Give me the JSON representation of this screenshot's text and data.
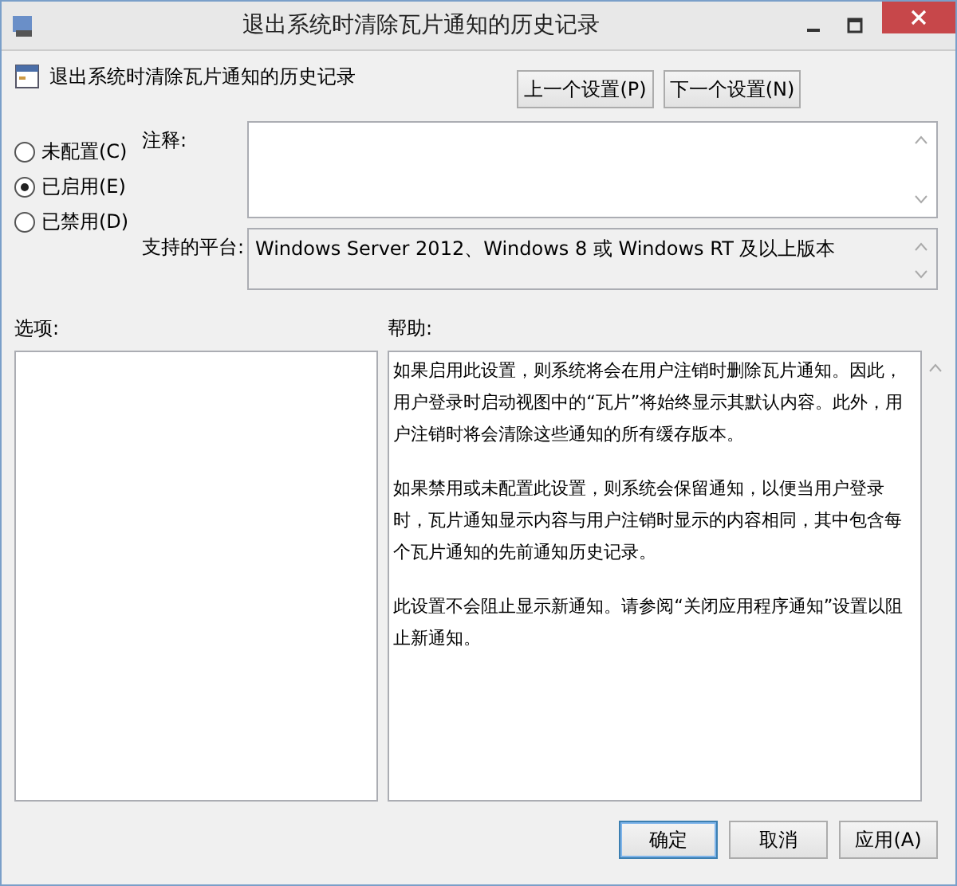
{
  "window": {
    "title": "退出系统时清除瓦片通知的历史记录"
  },
  "policy": {
    "name": "退出系统时清除瓦片通知的历史记录"
  },
  "nav_buttons": [
    "上一个设置(P)",
    "下一个设置(N)"
  ],
  "options": [
    {
      "label": "未配置(C)",
      "selected": false
    },
    {
      "label": "已启用(E)",
      "selected": true
    },
    {
      "label": "已禁用(D)",
      "selected": false
    }
  ],
  "comment": {
    "label": "注释:"
  },
  "platform": {
    "label": "支持的平台:",
    "value": "Windows Server 2012、Windows 8 或 Windows RT 及以上版本"
  },
  "options_label": "选项:",
  "help": {
    "label": "帮助:",
    "paragraphs": [
      "如果启用此设置，则系统将会在用户注销时删除瓦片通知。因此，用户登录时启动视图中的“瓦片”将始终显示其默认内容。此外，用户注销时将会清除这些通知的所有缓存版本。",
      "如果禁用或未配置此设置，则系统会保留通知，以便当用户登录时，瓦片通知显示内容与用户注销时显示的内容相同，其中包含每个瓦片通知的先前通知历史记录。",
      "此设置不会阻止显示新通知。请参阅“关闭应用程序通知”设置以阻止新通知。"
    ]
  },
  "footer_buttons": [
    {
      "label": "确定",
      "selected": true
    },
    {
      "label": "取消",
      "selected": false
    },
    {
      "label": "应用(A)",
      "selected": false
    }
  ]
}
